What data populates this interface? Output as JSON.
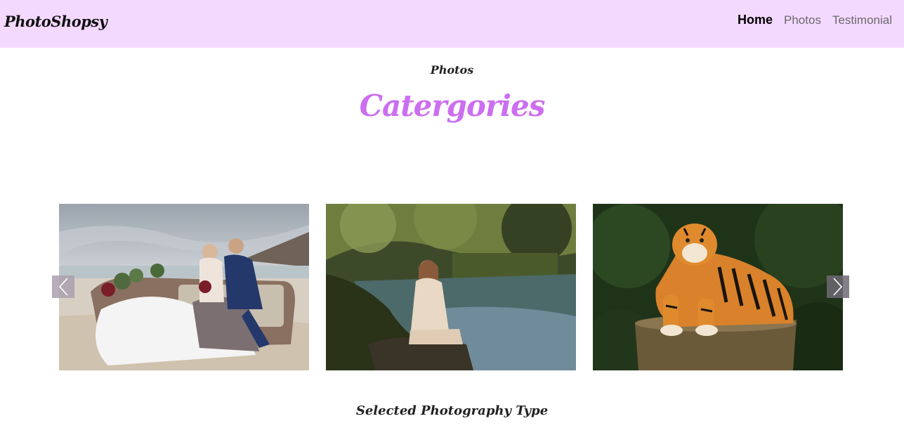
{
  "nav": {
    "brand": "PhotoShopsy",
    "links": [
      "Home",
      "Photos",
      "Testimonial"
    ]
  },
  "section": {
    "kicker": "Photos",
    "title": "Catergories",
    "footer_title": "Selected Photography Type"
  },
  "colors": {
    "navbar_bg": "#f4d9ff",
    "accent": "#cc6ef0"
  },
  "carousel": {
    "images": [
      "wedding-couple-on-beach-photo",
      "woman-by-pond-photo",
      "tiger-on-stump-photo"
    ],
    "prev_icon": "chevron-left-icon",
    "next_icon": "chevron-right-icon"
  }
}
